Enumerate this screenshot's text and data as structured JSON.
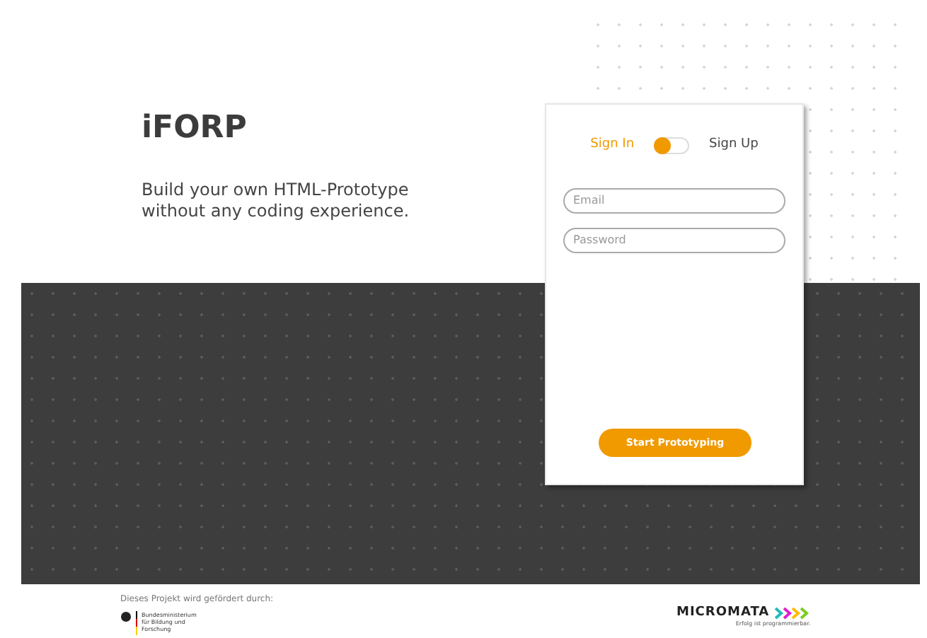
{
  "brand": {
    "title": "iFORP",
    "tagline": "Build your own HTML-Prototype without any coding experience."
  },
  "login": {
    "modes": [
      {
        "label": "Sign In",
        "selected": true
      },
      {
        "label": "Sign Up",
        "selected": false
      }
    ],
    "fields": [
      {
        "placeholder": "Email"
      },
      {
        "placeholder": "Password"
      }
    ],
    "mode_switch": {
      "on": false
    },
    "submit": "Start Prototyping"
  },
  "footer": {
    "funding_note": "Dieses Projekt wird gefördert durch:",
    "ministry": "Bundesministerium für Bildung und Forschung",
    "company": "MICROMATA",
    "slogan": "Erfolg ist programmierbar."
  }
}
